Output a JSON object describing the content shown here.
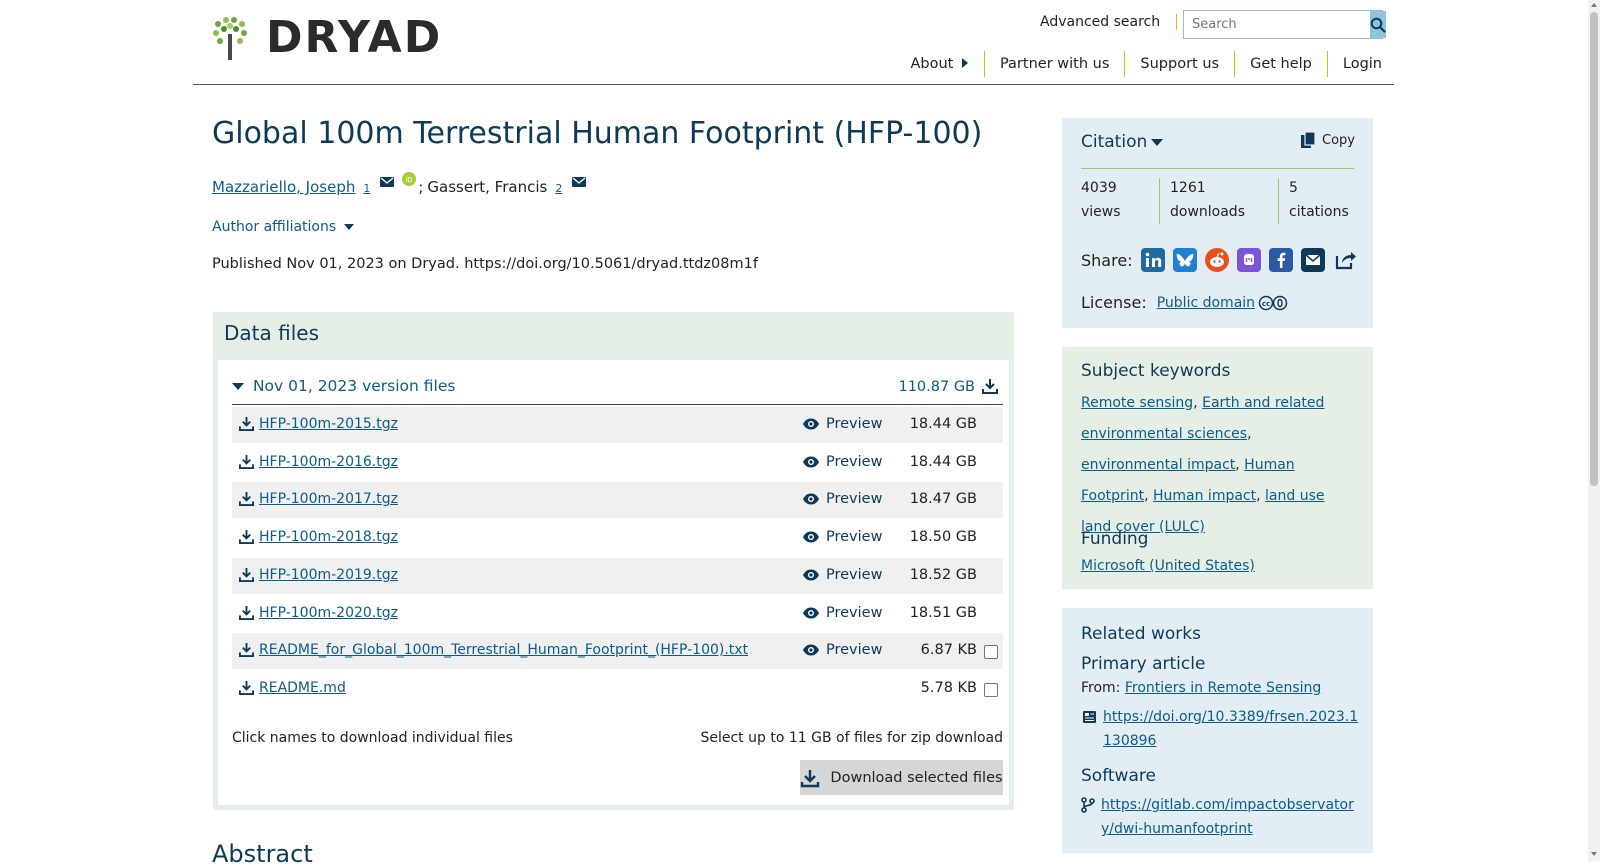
{
  "header": {
    "logo_text": "DRYAD",
    "advanced_search": "Advanced search",
    "search_placeholder": "Search",
    "nav": [
      "About",
      "Partner with us",
      "Support us",
      "Get help",
      "Login"
    ]
  },
  "dataset": {
    "title": "Global 100m Terrestrial Human Footprint (HFP-100)",
    "author1": "Mazzariello, Joseph",
    "author1_aff": "1",
    "separator": ";",
    "author2": "Gassert, Francis",
    "author2_aff": "2",
    "affiliations_toggle": "Author affiliations",
    "published": "Published Nov 01, 2023 on Dryad. https://doi.org/10.5061/dryad.ttdz08m1f"
  },
  "data_files": {
    "heading": "Data files",
    "version_label": "Nov 01, 2023 version files",
    "version_size": "110.87 GB",
    "preview_label": "Preview",
    "files": [
      {
        "name": "HFP-100m-2015.tgz",
        "size": "18.44 GB",
        "preview": true,
        "checkbox": false
      },
      {
        "name": "HFP-100m-2016.tgz",
        "size": "18.44 GB",
        "preview": true,
        "checkbox": false
      },
      {
        "name": "HFP-100m-2017.tgz",
        "size": "18.47 GB",
        "preview": true,
        "checkbox": false
      },
      {
        "name": "HFP-100m-2018.tgz",
        "size": "18.50 GB",
        "preview": true,
        "checkbox": false
      },
      {
        "name": "HFP-100m-2019.tgz",
        "size": "18.52 GB",
        "preview": true,
        "checkbox": false
      },
      {
        "name": "HFP-100m-2020.tgz",
        "size": "18.51 GB",
        "preview": true,
        "checkbox": false
      },
      {
        "name": "README_for_Global_100m_Terrestrial_Human_Footprint_(HFP-100).txt",
        "size": "6.87 KB",
        "preview": true,
        "checkbox": true
      },
      {
        "name": "README.md",
        "size": "5.78 KB",
        "preview": false,
        "checkbox": true
      }
    ],
    "click_names": "Click names to download individual files",
    "select_upto": "Select up to 11 GB of files for zip download",
    "download_selected": "Download selected files"
  },
  "abstract_heading": "Abstract",
  "citation": {
    "title": "Citation",
    "copy": "Copy",
    "views_count": "4039",
    "views_label": "views",
    "downloads_count": "1261",
    "downloads_label": "downloads",
    "citations_count": "5",
    "citations_label": "citations",
    "share_label": "Share:",
    "share_icons": [
      "linkedin-icon",
      "bluesky-icon",
      "reddit-icon",
      "mastodon-icon",
      "facebook-icon",
      "email-icon",
      "share-icon"
    ],
    "license_label": "License:",
    "license_value": "Public domain"
  },
  "keywords": {
    "title": "Subject keywords",
    "items": [
      "Remote sensing",
      "Earth and related environmental sciences",
      "environmental impact",
      "Human Footprint",
      "Human impact",
      "land use land cover (LULC)"
    ],
    "funding_title": "Funding",
    "funder": "Microsoft (United States)"
  },
  "related": {
    "title": "Related works",
    "primary_title": "Primary article",
    "from_label": "From:",
    "journal": "Frontiers in Remote Sensing",
    "primary_doi": "https://doi.org/10.3389/frsen.2023.1130896",
    "software_title": "Software",
    "software_url": "https://gitlab.com/impactobservatory/dwi-humanfootprint"
  },
  "colors": {
    "brand_dark": "#0e3a57",
    "link": "#0b5c8a",
    "data_panel": "#e6efe6",
    "sidebar_blue": "#e3eef4",
    "accent_rule": "#a9c46c"
  }
}
